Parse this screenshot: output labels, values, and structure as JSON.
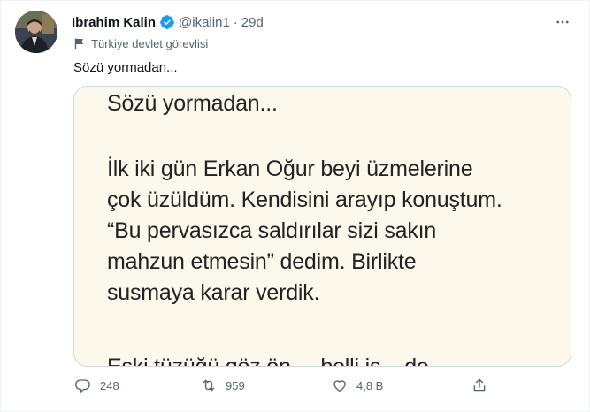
{
  "author": {
    "name": "Ibrahim Kalin",
    "handle": "@ikalin1",
    "separator": "·",
    "time": "29d",
    "label": "Türkiye devlet görevlisi"
  },
  "tweet": {
    "text": "Sözü yormadan..."
  },
  "media": {
    "title": "Sözü yormadan...",
    "lines": [
      "İlk iki gün Erkan Oğur beyi üzmelerine",
      "çok üzüldüm. Kendisini arayıp konuştum.",
      "“Bu pervasızca saldırılar sizi sakın",
      "mahzun etmesin” dedim. Birlikte",
      "susmaya karar verdik."
    ],
    "cut_line": "Eski tüzüğü göz ön ... belli iş ...de ..."
  },
  "actions": {
    "reply_count": "248",
    "retweet_count": "959",
    "like_count": "4,8 B"
  },
  "icons": {
    "verified": "verified-badge-icon",
    "more": "more-icon",
    "flag": "flag-icon",
    "reply": "reply-icon",
    "retweet": "retweet-icon",
    "like": "like-icon",
    "share": "share-icon"
  },
  "colors": {
    "accent": "#1d9bf0",
    "muted": "#536471",
    "media_bg": "#fdf8ec"
  }
}
